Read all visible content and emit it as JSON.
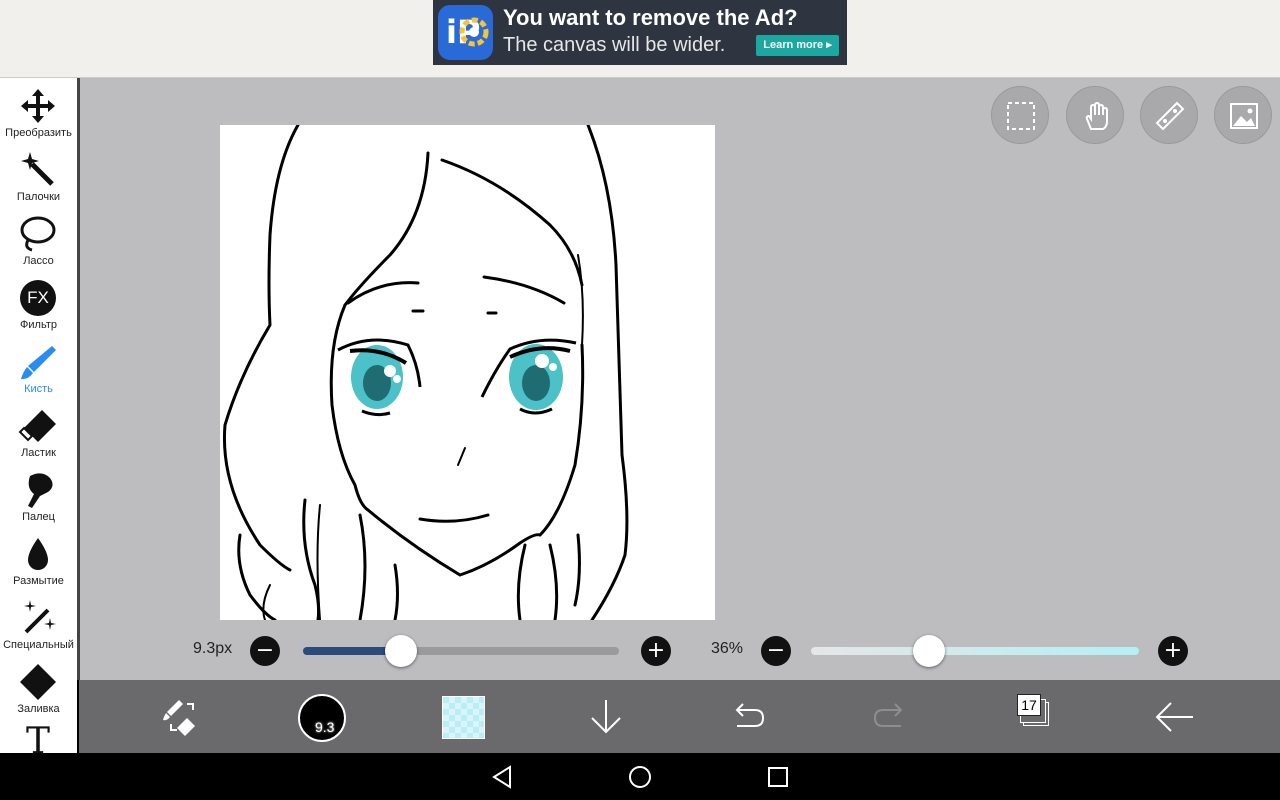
{
  "ad": {
    "title": "You want to remove the Ad?",
    "subtitle": "The canvas will be wider.",
    "cta": "Learn more ▸",
    "logo_text": "iP"
  },
  "toolbar": {
    "tools": [
      {
        "label": "Преобразить",
        "icon": "move-icon"
      },
      {
        "label": "Палочки",
        "icon": "magic-wand-icon"
      },
      {
        "label": "Лассо",
        "icon": "lasso-icon"
      },
      {
        "label": "Фильтр",
        "icon": "fx-icon",
        "icon_text": "FX"
      },
      {
        "label": "Кисть",
        "icon": "brush-icon",
        "active": true
      },
      {
        "label": "Ластик",
        "icon": "eraser-icon"
      },
      {
        "label": "Палец",
        "icon": "smudge-finger-icon"
      },
      {
        "label": "Размытие",
        "icon": "blur-drop-icon"
      },
      {
        "label": "Специальный",
        "icon": "special-brush-icon"
      },
      {
        "label": "Заливка",
        "icon": "fill-bucket-icon"
      },
      {
        "label": "",
        "icon": "text-icon",
        "icon_text": "T"
      }
    ]
  },
  "top_buttons": [
    "selection-icon",
    "hand-icon",
    "ruler-icon",
    "image-icon"
  ],
  "brush": {
    "size_label": "9.3px",
    "size_fraction": 0.31,
    "opacity_label": "36%",
    "opacity_fraction": 0.36,
    "indicator_text": "9.3"
  },
  "bottombar": {
    "layers_count": "17"
  },
  "colors": {
    "accent": "#2a8cf0",
    "size_track_fill": "#2b4c7a",
    "opacity_track": "#b4f0f4",
    "current_color": "#b8eef4",
    "eye_color": "#4cc2c8"
  }
}
